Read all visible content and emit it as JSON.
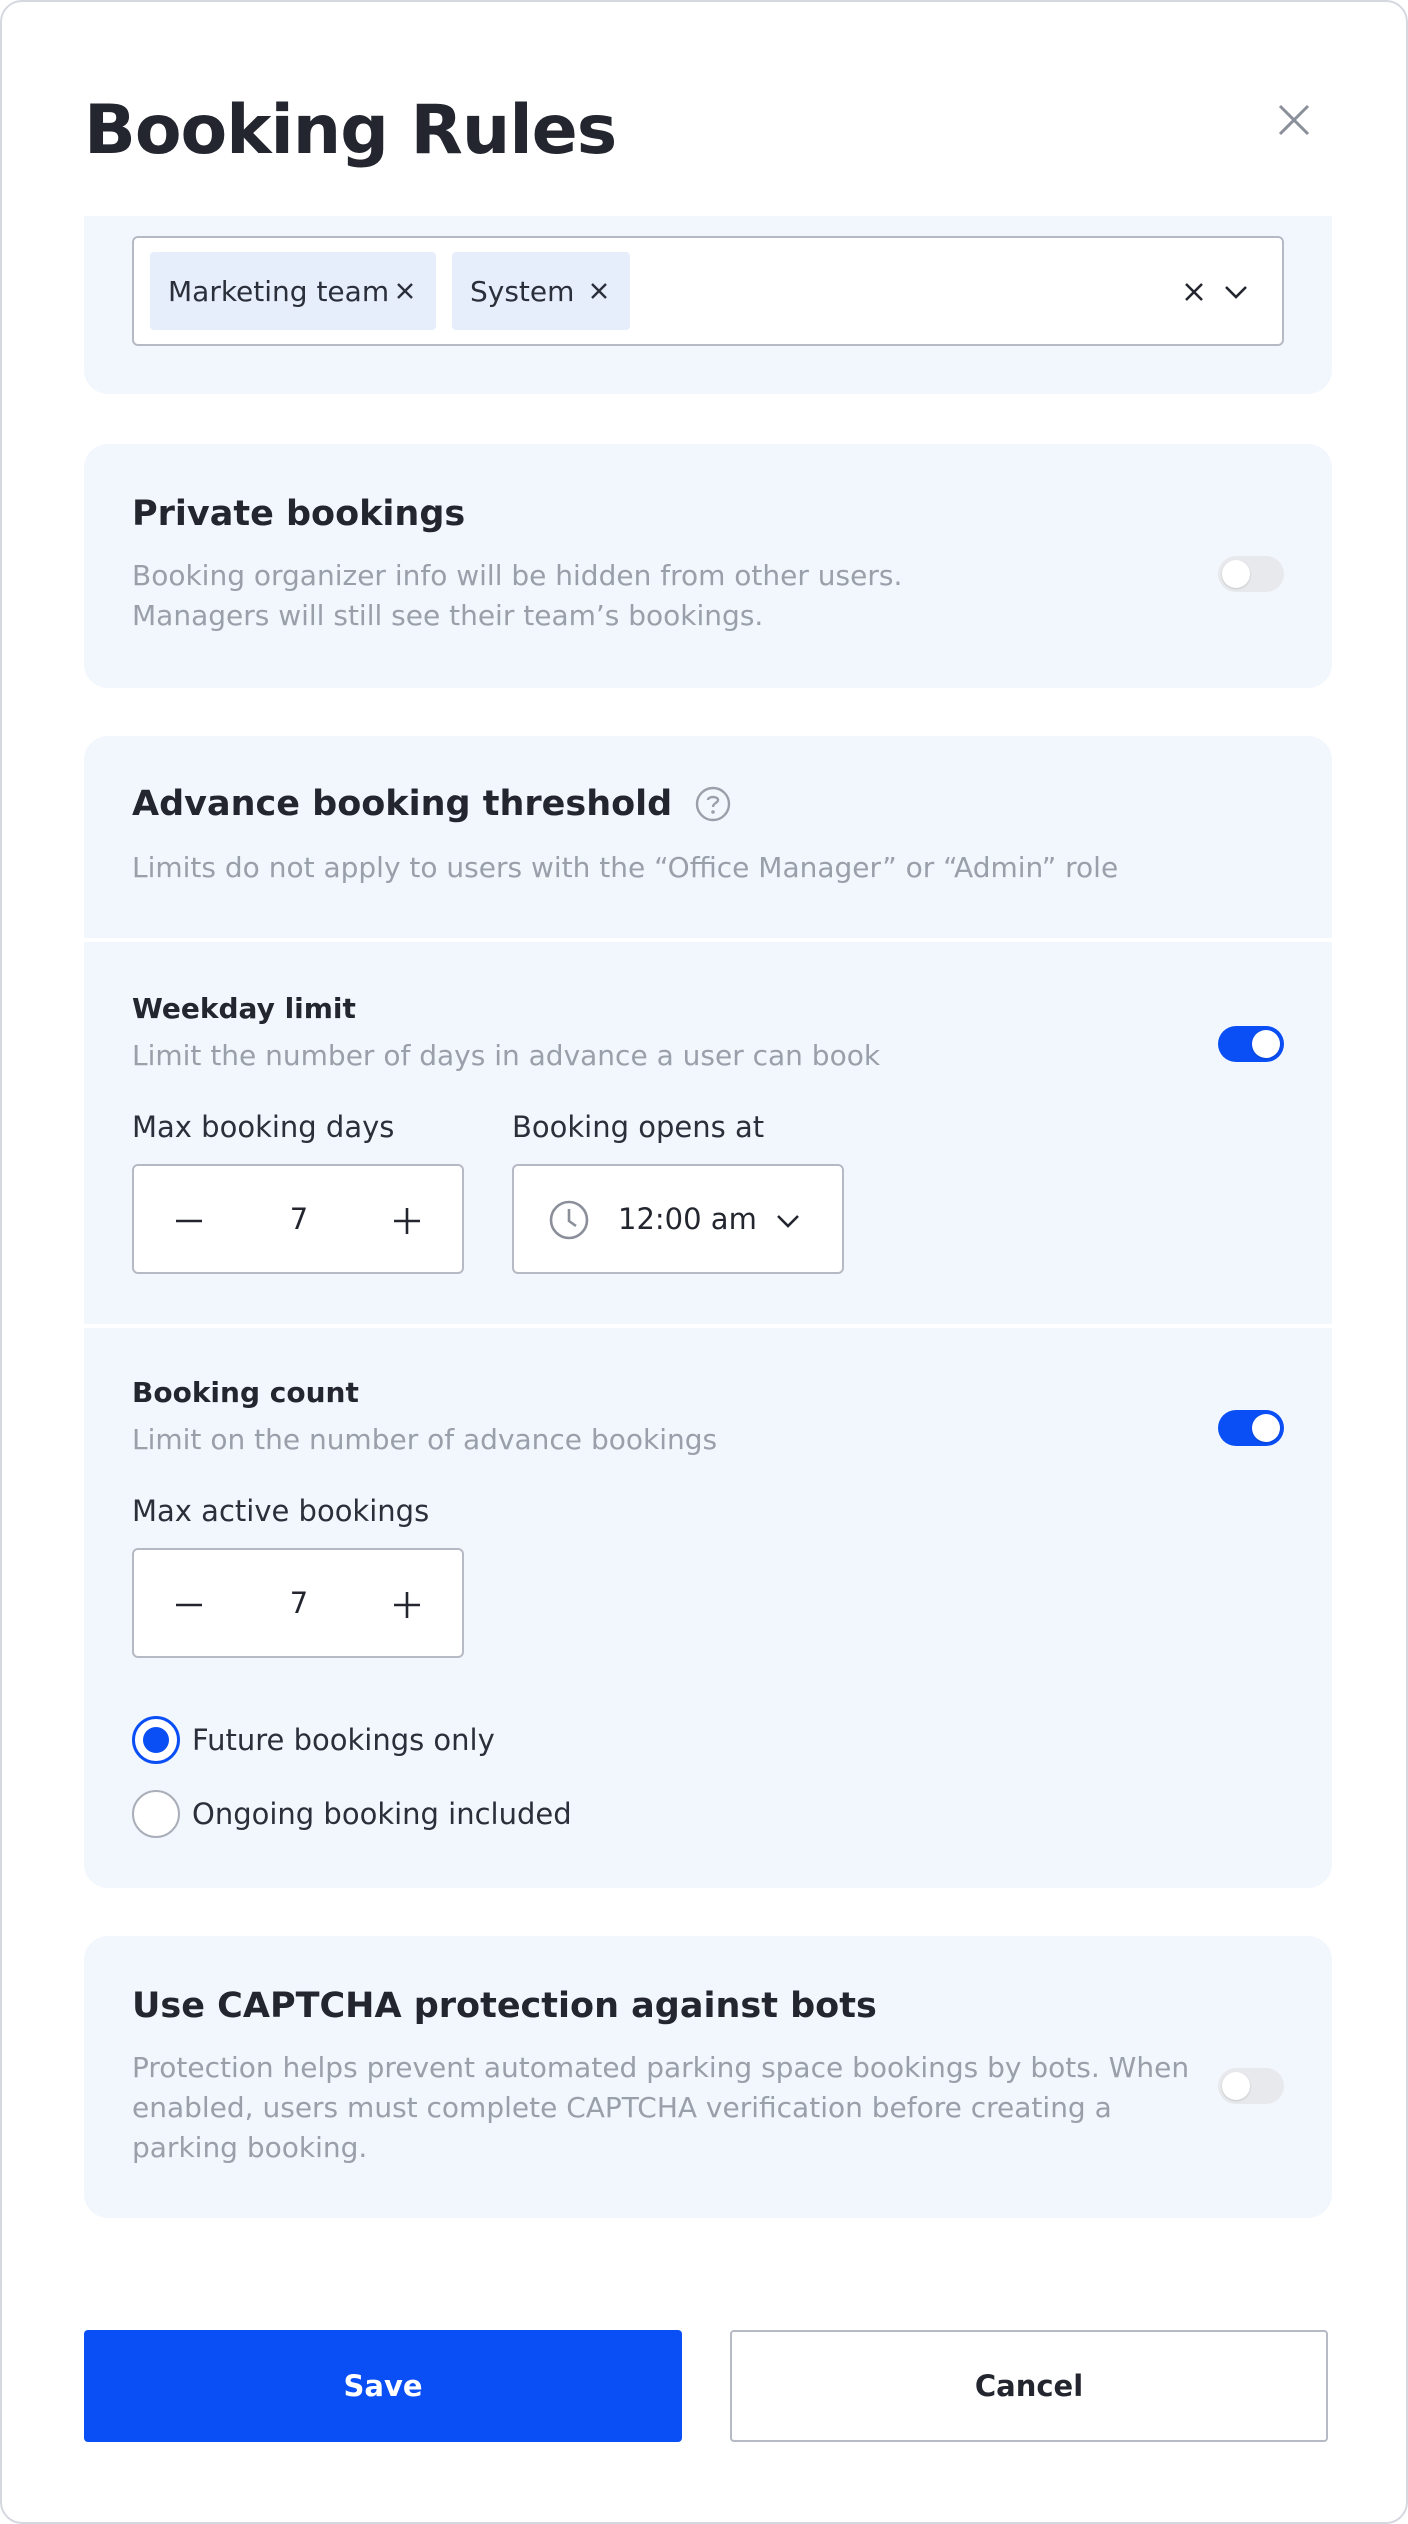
{
  "dialog": {
    "title": "Booking Rules"
  },
  "groups_selector": {
    "chips": [
      {
        "label": "Marketing team"
      },
      {
        "label": "System"
      }
    ]
  },
  "private_bookings": {
    "title": "Private bookings",
    "description_line1": "Booking organizer info will be hidden from other users.",
    "description_line2": "Managers will still see their team’s bookings.",
    "enabled": false
  },
  "advance_threshold": {
    "title": "Advance booking threshold",
    "description": "Limits do not apply to users with the “Office Manager” or “Admin” role",
    "weekday_limit": {
      "title": "Weekday limit",
      "description": "Limit the number of days in advance a user can book",
      "enabled": true,
      "max_days_label": "Max booking days",
      "max_days_value": "7",
      "opens_at_label": "Booking opens at",
      "opens_at_value": "12:00 am"
    },
    "booking_count": {
      "title": "Booking count",
      "description": "Limit on the number of advance bookings",
      "enabled": true,
      "max_active_label": "Max active bookings",
      "max_active_value": "7",
      "options": [
        {
          "label": "Future bookings only",
          "selected": true
        },
        {
          "label": "Ongoing booking included",
          "selected": false
        }
      ]
    }
  },
  "captcha": {
    "title": "Use CAPTCHA protection against bots",
    "description_line1": "Protection helps prevent automated parking space bookings by bots. When",
    "description_line2": "enabled, users must complete CAPTCHA verification before creating a",
    "description_line3": "parking booking.",
    "enabled": false
  },
  "footer": {
    "save_label": "Save",
    "cancel_label": "Cancel"
  },
  "colors": {
    "accent": "#0a4ff5",
    "card_bg": "#f2f6fd",
    "chip_bg": "#e6eefc",
    "muted_text": "#9aa0aa"
  }
}
